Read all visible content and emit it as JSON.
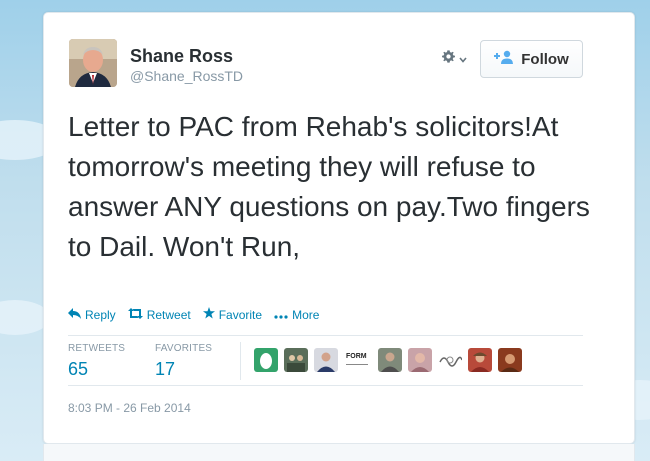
{
  "user": {
    "name": "Shane Ross",
    "handle": "@Shane_RossTD"
  },
  "follow_button": {
    "label": "Follow"
  },
  "tweet": {
    "text": "Letter to PAC from Rehab's solicitors!At tomorrow's meeting they will refuse to answer ANY questions on pay.Two fingers to Dail. Won't Run,"
  },
  "actions": {
    "reply": "Reply",
    "retweet": "Retweet",
    "favorite": "Favorite",
    "more": "More"
  },
  "stats": {
    "retweets_label": "RETWEETS",
    "retweets_value": "65",
    "favorites_label": "FAVORITES",
    "favorites_value": "17"
  },
  "favoriter_avatars": [
    "egg-avatar",
    "group-avatar",
    "person-avatar",
    "form-architecture-logo",
    "person-avatar",
    "person-avatar",
    "logo-avatar",
    "person-avatar",
    "person-avatar"
  ],
  "form_logo_text": "FORM",
  "timestamp": "8:03 PM - 26 Feb 2014",
  "colors": {
    "link": "#0084b4",
    "text": "#292f33",
    "muted": "#8899a6",
    "background": "#c0deed"
  }
}
